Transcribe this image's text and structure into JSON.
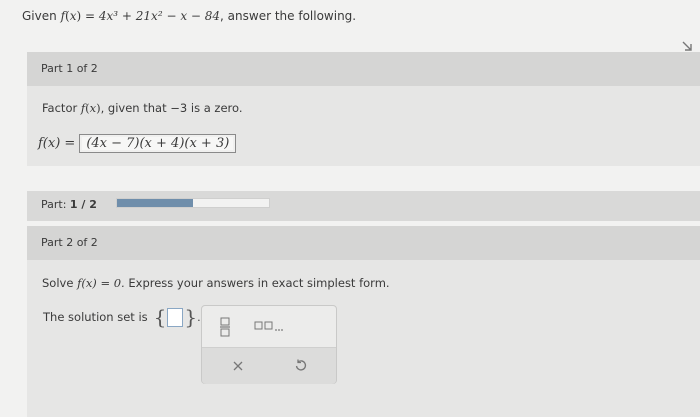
{
  "question": {
    "given_prefix": "Given",
    "function_name": "f",
    "variable": "x",
    "given_rhs": "4x³ + 21x² − x − 84",
    "given_suffix": ", answer the following."
  },
  "part1": {
    "header": "Part 1 of 2",
    "prompt_prefix": "Factor",
    "prompt_suffix": ", given that −3 is a zero.",
    "answer_lhs": "f(x) =",
    "answer_value": "(4x − 7)(x + 4)(x + 3)"
  },
  "progress": {
    "label_prefix": "Part:",
    "label_value": "1 / 2",
    "fraction": 0.5
  },
  "part2": {
    "header": "Part 2 of 2",
    "prompt_prefix": "Solve",
    "prompt_equation": "f(x) = 0.",
    "prompt_suffix": "Express your answers in exact simplest form.",
    "solution_label": "The solution set is",
    "solution_value": ""
  },
  "toolbox": {
    "icons": [
      "fraction-icon",
      "list-icon",
      "clear-icon",
      "undo-icon"
    ]
  },
  "colors": {
    "background": "#f2f2f1",
    "header": "#d5d5d4",
    "progress_fill": "#6f8eab"
  }
}
